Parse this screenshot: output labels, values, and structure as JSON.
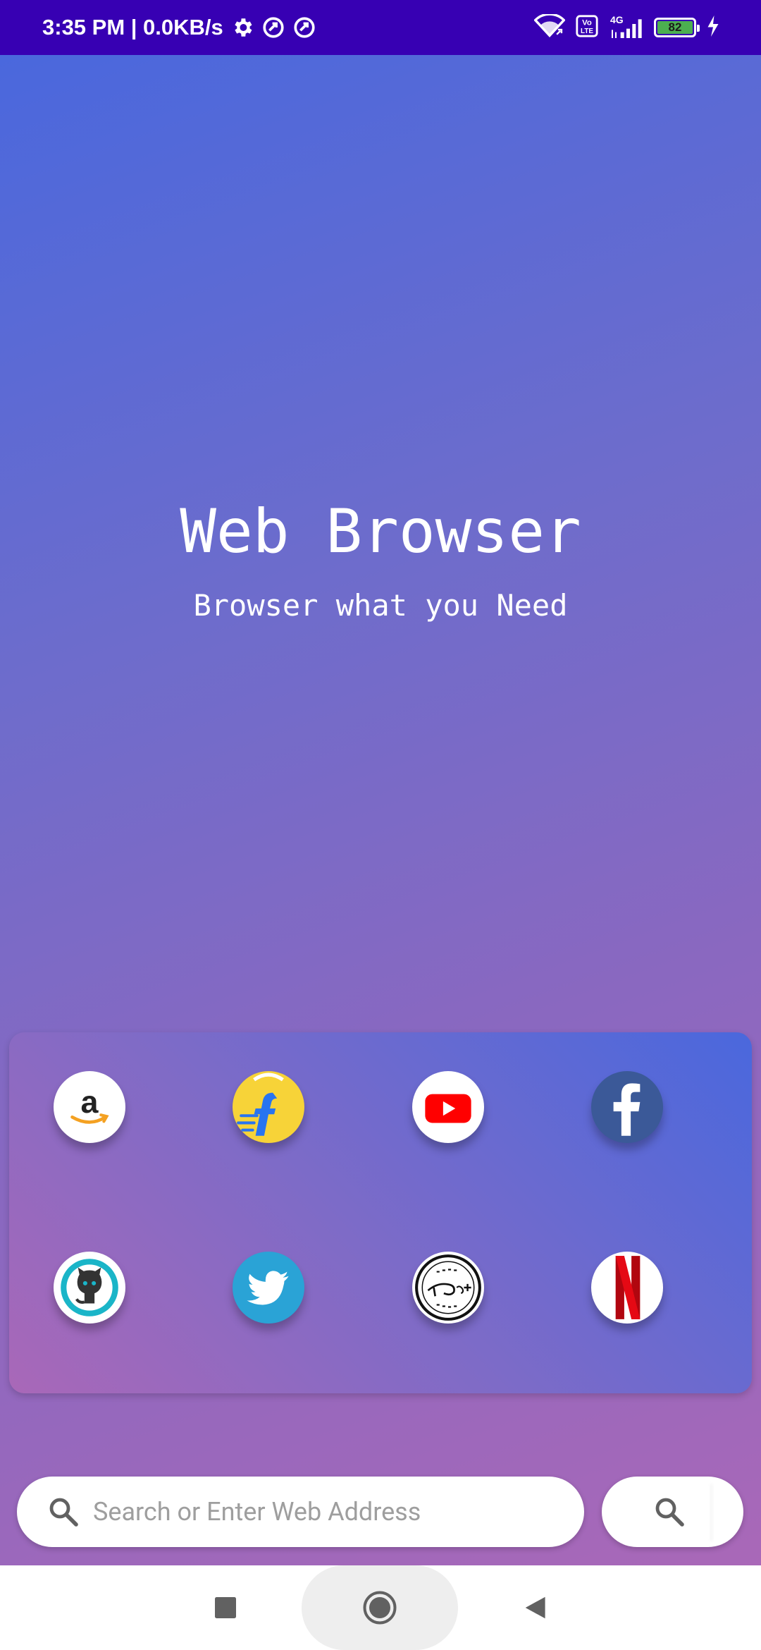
{
  "status_bar": {
    "time": "3:35 PM | 0.0KB/s",
    "battery": "82",
    "network": "4G",
    "icons": [
      "settings-icon",
      "data-saver-icon",
      "data-saver-icon",
      "wifi-icon",
      "volte-icon",
      "signal-icon",
      "battery-icon",
      "charging-icon"
    ]
  },
  "hero": {
    "title": "Web Browser",
    "subtitle": "Browser what you Need"
  },
  "shortcuts": [
    {
      "name": "amazon",
      "icon": "amazon-icon"
    },
    {
      "name": "flipkart",
      "icon": "flipkart-icon"
    },
    {
      "name": "youtube",
      "icon": "youtube-icon"
    },
    {
      "name": "facebook",
      "icon": "facebook-icon"
    },
    {
      "name": "github",
      "icon": "github-icon"
    },
    {
      "name": "twitter",
      "icon": "twitter-icon"
    },
    {
      "name": "disney-plus",
      "icon": "disney-plus-icon"
    },
    {
      "name": "netflix",
      "icon": "netflix-icon"
    }
  ],
  "search": {
    "placeholder": "Search or Enter Web Address",
    "value": ""
  },
  "colors": {
    "status_bar": "#3700b3",
    "gradient_start": "#4a68dd",
    "gradient_end": "#a968b8"
  },
  "nav": {
    "icons": [
      "recents-icon",
      "home-icon",
      "back-icon"
    ]
  }
}
